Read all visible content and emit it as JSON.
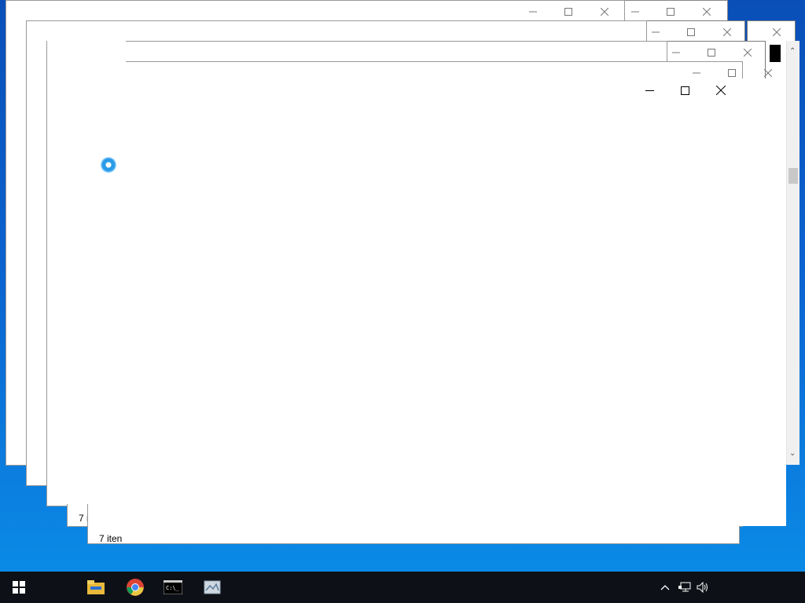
{
  "windows": {
    "w1": {
      "partial_title": ""
    },
    "status": {
      "w4_count": "7 i",
      "w5_count": "7 iten"
    }
  },
  "taskbar": {
    "start_icon": "windows-logo-icon",
    "apps": [
      {
        "name": "file-explorer-icon"
      },
      {
        "name": "chrome-icon"
      },
      {
        "name": "command-prompt-icon"
      },
      {
        "name": "photos-icon"
      }
    ],
    "tray": {
      "show_hidden_icon": "chevron-up-icon",
      "network_icon": "network-icon",
      "volume_icon": "volume-icon"
    }
  },
  "cursor": {
    "state": "busy-spinner-icon"
  }
}
